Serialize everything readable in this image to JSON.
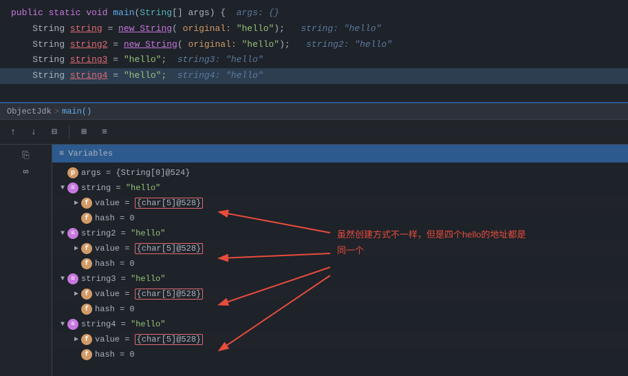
{
  "editor": {
    "lines": [
      {
        "id": "line1",
        "parts": [
          {
            "text": "public ",
            "cls": "kw"
          },
          {
            "text": "static ",
            "cls": "kw"
          },
          {
            "text": "void ",
            "cls": "kw"
          },
          {
            "text": "main",
            "cls": "method"
          },
          {
            "text": "(",
            "cls": "plain"
          },
          {
            "text": "String",
            "cls": "type"
          },
          {
            "text": "[] args) {  ",
            "cls": "plain"
          },
          {
            "text": "args: {}",
            "cls": "comment-inline"
          }
        ]
      },
      {
        "id": "line2",
        "parts": [
          {
            "text": "    String ",
            "cls": "plain"
          },
          {
            "text": "string",
            "cls": "var-name"
          },
          {
            "text": " = ",
            "cls": "plain"
          },
          {
            "text": "new String",
            "cls": "new-kw"
          },
          {
            "text": "( ",
            "cls": "plain"
          },
          {
            "text": "original:",
            "cls": "param"
          },
          {
            "text": " \"hello\"",
            "cls": "str"
          },
          {
            "text": ");   ",
            "cls": "plain"
          },
          {
            "text": "string: \"hello\"",
            "cls": "comment-inline"
          }
        ]
      },
      {
        "id": "line3",
        "parts": [
          {
            "text": "    String ",
            "cls": "plain"
          },
          {
            "text": "string2",
            "cls": "var-name"
          },
          {
            "text": " = ",
            "cls": "plain"
          },
          {
            "text": "new String",
            "cls": "new-kw"
          },
          {
            "text": "( ",
            "cls": "plain"
          },
          {
            "text": "original:",
            "cls": "param"
          },
          {
            "text": " \"hello\"",
            "cls": "str"
          },
          {
            "text": ");   ",
            "cls": "plain"
          },
          {
            "text": "string2: \"hello\"",
            "cls": "comment-inline"
          }
        ]
      },
      {
        "id": "line4",
        "parts": [
          {
            "text": "    String ",
            "cls": "plain"
          },
          {
            "text": "string3",
            "cls": "var-name"
          },
          {
            "text": " = ",
            "cls": "plain"
          },
          {
            "text": "\"hello\";  ",
            "cls": "str"
          },
          {
            "text": "string3: \"hello\"",
            "cls": "comment-inline"
          }
        ]
      },
      {
        "id": "line5",
        "highlighted": true,
        "parts": [
          {
            "text": "    String ",
            "cls": "plain"
          },
          {
            "text": "string4",
            "cls": "var-name"
          },
          {
            "text": " = ",
            "cls": "plain"
          },
          {
            "text": "\"hello\";",
            "cls": "str"
          },
          {
            "text": "  ",
            "cls": "plain"
          },
          {
            "text": "string4: \"hello\"",
            "cls": "comment-inline"
          }
        ]
      }
    ]
  },
  "breadcrumb": {
    "class_name": "ObjectJdk",
    "separator": " > ",
    "method_name": "main()"
  },
  "toolbar": {
    "buttons": [
      {
        "id": "btn-up",
        "icon": "↑",
        "label": "up"
      },
      {
        "id": "btn-down",
        "icon": "↓",
        "label": "down"
      },
      {
        "id": "btn-filter",
        "icon": "⊟",
        "label": "filter"
      },
      {
        "id": "btn-table",
        "icon": "⊞",
        "label": "table"
      },
      {
        "id": "btn-list",
        "icon": "≡",
        "label": "list"
      }
    ]
  },
  "variables": {
    "header": "Variables",
    "items": [
      {
        "id": "args",
        "indent": 0,
        "expandable": false,
        "icon": "p",
        "icon_class": "icon-p",
        "text": "args = {String[0]@524}"
      },
      {
        "id": "string-group",
        "indent": 0,
        "expandable": true,
        "expanded": true,
        "icon": "e",
        "icon_class": "icon-e",
        "text": "string = \"hello\""
      },
      {
        "id": "string-value",
        "indent": 1,
        "expandable": true,
        "expanded": false,
        "icon": "f",
        "icon_class": "icon-f",
        "text": "value = {char[5]@528}",
        "highlighted": true
      },
      {
        "id": "string-hash",
        "indent": 1,
        "expandable": false,
        "icon": "f",
        "icon_class": "icon-f",
        "text": "hash = 0"
      },
      {
        "id": "string2-group",
        "indent": 0,
        "expandable": true,
        "expanded": true,
        "icon": "e",
        "icon_class": "icon-e",
        "text": "string2 = \"hello\""
      },
      {
        "id": "string2-value",
        "indent": 1,
        "expandable": true,
        "expanded": false,
        "icon": "f",
        "icon_class": "icon-f",
        "text": "value = {char[5]@528}",
        "highlighted": true
      },
      {
        "id": "string2-hash",
        "indent": 1,
        "expandable": false,
        "icon": "f",
        "icon_class": "icon-f",
        "text": "hash = 0"
      },
      {
        "id": "string3-group",
        "indent": 0,
        "expandable": true,
        "expanded": true,
        "icon": "e",
        "icon_class": "icon-e",
        "text": "string3 = \"hello\""
      },
      {
        "id": "string3-value",
        "indent": 1,
        "expandable": true,
        "expanded": false,
        "icon": "f",
        "icon_class": "icon-f",
        "text": "value = {char[5]@528}",
        "highlighted": true
      },
      {
        "id": "string3-hash",
        "indent": 1,
        "expandable": false,
        "icon": "f",
        "icon_class": "icon-f",
        "text": "hash = 0"
      },
      {
        "id": "string4-group",
        "indent": 0,
        "expandable": true,
        "expanded": true,
        "icon": "e",
        "icon_class": "icon-e",
        "text": "string4 = \"hello\""
      },
      {
        "id": "string4-value",
        "indent": 1,
        "expandable": true,
        "expanded": false,
        "icon": "f",
        "icon_class": "icon-f",
        "text": "value = {char[5]@528}",
        "highlighted": true
      },
      {
        "id": "string4-hash",
        "indent": 1,
        "expandable": false,
        "icon": "f",
        "icon_class": "icon-f",
        "text": "hash = 0"
      }
    ]
  },
  "annotation": {
    "text": "虽然创建方式不一样，但是四个hello的地址都是同一个"
  },
  "colors": {
    "accent_blue": "#2d5a8e",
    "arrow_red": "#e74c3c",
    "highlight_box": "#e06c75"
  }
}
